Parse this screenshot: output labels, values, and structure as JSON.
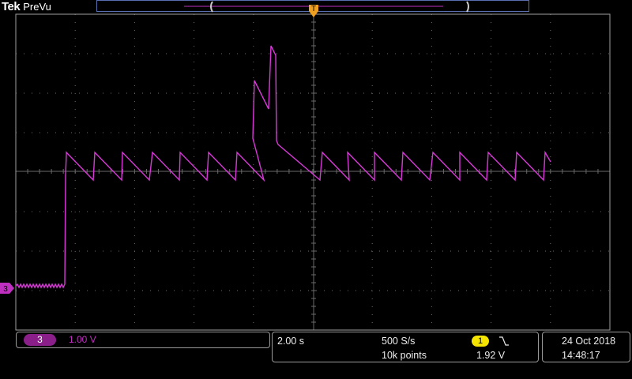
{
  "brand": {
    "name": "Tek",
    "mode": "PreVu"
  },
  "trigger_marker": {
    "label": "T",
    "color": "#f0a020"
  },
  "channel_marker": {
    "label": "3",
    "color": "#c030c0"
  },
  "channel": {
    "number": "3",
    "scale": "1.00 V",
    "color": "#c030c0"
  },
  "horizontal": {
    "time_per_div": "2.00 s",
    "sample_rate": "500 S/s",
    "record_length": "10k points"
  },
  "trigger": {
    "source": "1",
    "slope_icon": "falling-edge-icon",
    "level": "1.92 V",
    "color": "#f4e400"
  },
  "datetime": {
    "date": "24 Oct  2018",
    "time": "14:48:17"
  },
  "colors": {
    "trace": "#d838d8",
    "grid": "#6a6a6a",
    "frame": "#a0a0a0",
    "record_bar": "#5a6fb0"
  }
}
